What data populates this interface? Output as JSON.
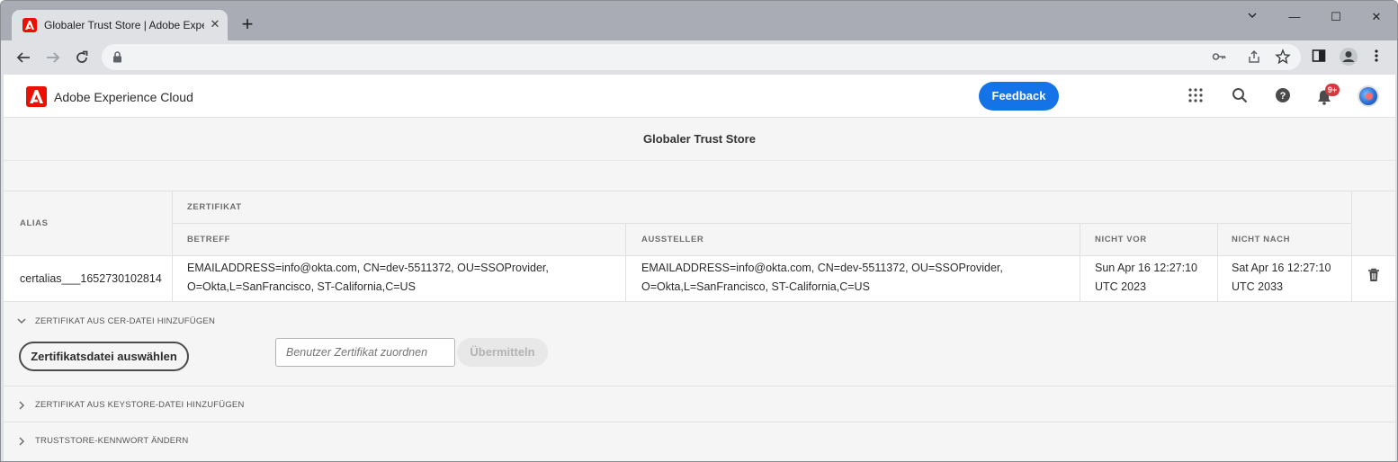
{
  "browser": {
    "tab_title": "Globaler Trust Store | Adobe Experience Manager",
    "tab_close": "✕",
    "new_tab": "+",
    "window_controls": {
      "minimize": "—",
      "maximize": "☐",
      "close": "✕"
    },
    "address_value": ""
  },
  "app_header": {
    "brand": "Adobe Experience Cloud",
    "feedback_label": "Feedback",
    "notification_badge": "9+"
  },
  "page": {
    "title": "Globaler Trust Store"
  },
  "table": {
    "headers": {
      "alias": "ALIAS",
      "zertifikat": "ZERTIFIKAT",
      "betreff": "BETREFF",
      "aussteller": "AUSSTELLER",
      "nicht_vor": "NICHT VOR",
      "nicht_nach": "NICHT NACH"
    },
    "rows": [
      {
        "alias": "certalias___1652730102814",
        "betreff_line1": "EMAILADDRESS=info@okta.com, CN=dev-5511372, OU=SSOProvider,",
        "betreff_line2": "O=Okta,L=SanFrancisco, ST-California,C=US",
        "aussteller_line1": "EMAILADDRESS=info@okta.com, CN=dev-5511372, OU=SSOProvider,",
        "aussteller_line2": "O=Okta,L=SanFrancisco, ST-California,C=US",
        "nicht_vor_line1": "Sun Apr 16 12:27:10",
        "nicht_vor_line2": "UTC 2023",
        "nicht_nach_line1": "Sat Apr 16 12:27:10",
        "nicht_nach_line2": "UTC 2033"
      }
    ]
  },
  "accordion": {
    "cer": {
      "label": "ZERTIFIKAT AUS CER-DATEI HINZUFÜGEN",
      "expanded": true,
      "select_file_button": "Zertifikatsdatei auswählen",
      "user_placeholder": "Benutzer Zertifikat zuordnen",
      "submit_button": "Übermitteln"
    },
    "keystore": {
      "label": "ZERTIFIKAT AUS KEYSTORE-DATEI HINZUFÜGEN",
      "expanded": false
    },
    "password": {
      "label": "TRUSTSTORE-KENNWORT ÄNDERN",
      "expanded": false
    }
  },
  "colors": {
    "accent": "#1473e6",
    "adobe_red": "#eb1000",
    "badge_red": "#d7373f"
  },
  "icons": [
    "adobe-logo-icon",
    "back-arrow-icon",
    "forward-arrow-icon",
    "reload-icon",
    "lock-icon",
    "key-icon",
    "share-icon",
    "star-icon",
    "sidepanel-icon",
    "profile-icon",
    "kebab-menu-icon",
    "apps-grid-icon",
    "search-icon",
    "help-icon",
    "bell-icon",
    "trash-icon",
    "chevron-down-icon",
    "chevron-right-icon"
  ]
}
